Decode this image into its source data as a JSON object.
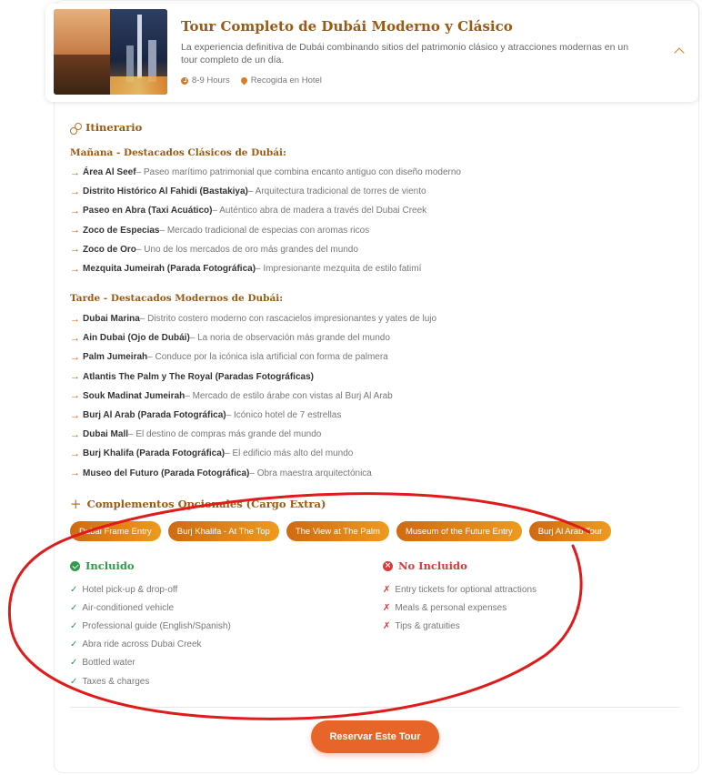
{
  "tour": {
    "title": "Tour Completo de Dubái Moderno y Clásico",
    "description": "La experiencia definitiva de Dubái combinando sitios del patrimonio clásico y atracciones modernas en un tour completo de un día.",
    "duration": "8-9 Hours",
    "pickup": "Recogida en Hotel"
  },
  "itinerary": {
    "title": "Itinerario",
    "morning_title": "Mañana - Destacados Clásicos de Dubái:",
    "morning": [
      {
        "name": "Área Al Seef",
        "desc": " – Paseo marítimo patrimonial que combina encanto antiguo con diseño moderno"
      },
      {
        "name": "Distrito Histórico Al Fahidi (Bastakiya)",
        "desc": " – Arquitectura tradicional de torres de viento"
      },
      {
        "name": "Paseo en Abra (Taxi Acuático)",
        "desc": " – Auténtico abra de madera a través del Dubai Creek"
      },
      {
        "name": "Zoco de Especias",
        "desc": " – Mercado tradicional de especias con aromas ricos"
      },
      {
        "name": "Zoco de Oro",
        "desc": " – Uno de los mercados de oro más grandes del mundo"
      },
      {
        "name": "Mezquita Jumeirah (Parada Fotográfica)",
        "desc": " – Impresionante mezquita de estilo fatimí"
      }
    ],
    "afternoon_title": "Tarde - Destacados Modernos de Dubái:",
    "afternoon": [
      {
        "name": "Dubai Marina",
        "desc": " – Distrito costero moderno con rascacielos impresionantes y yates de lujo"
      },
      {
        "name": "Ain Dubai (Ojo de Dubái)",
        "desc": " – La noria de observación más grande del mundo"
      },
      {
        "name": "Palm Jumeirah",
        "desc": " – Conduce por la icónica isla artificial con forma de palmera"
      },
      {
        "name": "Atlantis The Palm y The Royal (Paradas Fotográficas)",
        "desc": ""
      },
      {
        "name": "Souk Madinat Jumeirah",
        "desc": " – Mercado de estilo árabe con vistas al Burj Al Arab"
      },
      {
        "name": "Burj Al Arab (Parada Fotográfica)",
        "desc": " – Icónico hotel de 7 estrellas"
      },
      {
        "name": "Dubai Mall",
        "desc": " – El destino de compras más grande del mundo"
      },
      {
        "name": "Burj Khalifa (Parada Fotográfica)",
        "desc": " – El edificio más alto del mundo"
      },
      {
        "name": "Museo del Futuro (Parada Fotográfica)",
        "desc": " – Obra maestra arquitectónica"
      }
    ]
  },
  "addons": {
    "title": "Complementos Opcionales (Cargo Extra)",
    "items": [
      "Dubai Frame Entry",
      "Burj Khalifa - At The Top",
      "The View at The Palm",
      "Museum of the Future Entry",
      "Burj Al Arab Tour"
    ]
  },
  "included": {
    "title": "Incluido",
    "items": [
      "Hotel pick-up & drop-off",
      "Air-conditioned vehicle",
      "Professional guide (English/Spanish)",
      "Abra ride across Dubai Creek",
      "Bottled water",
      "Taxes & charges"
    ]
  },
  "not_included": {
    "title": "No Incluido",
    "items": [
      "Entry tickets for optional attractions",
      "Meals & personal expenses",
      "Tips & gratuities"
    ]
  },
  "cta": {
    "book_label": "Reservar Este Tour"
  },
  "colors": {
    "accent": "#e8652a",
    "heading": "#9a5a13",
    "included": "#2e9b4a",
    "excluded": "#d83a3a",
    "annotation": "#e01b1b"
  }
}
